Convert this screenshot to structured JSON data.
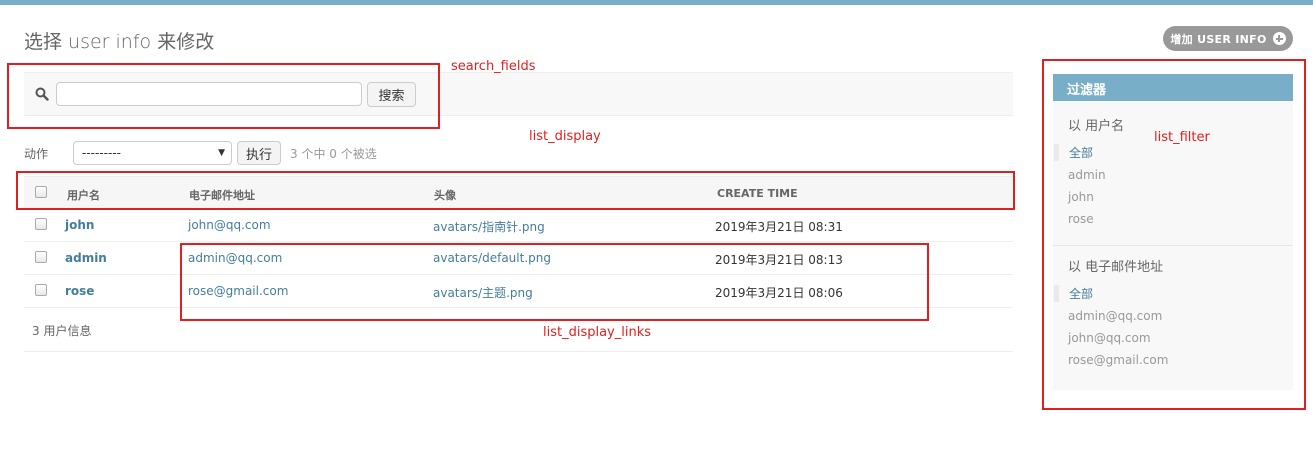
{
  "page": {
    "title": "选择 user info 来修改",
    "add_button": "增加 USER INFO"
  },
  "search": {
    "value": "",
    "button": "搜索"
  },
  "actions": {
    "label": "动作",
    "select_value": "---------",
    "go_button": "执行",
    "counter": "3 个中 0 个被选"
  },
  "table": {
    "columns": [
      "用户名",
      "电子邮件地址",
      "头像",
      "CREATE TIME"
    ],
    "rows": [
      {
        "username": "john",
        "email": "john@qq.com",
        "avatar": "avatars/指南针.png",
        "create_time": "2019年3月21日 08:31"
      },
      {
        "username": "admin",
        "email": "admin@qq.com",
        "avatar": "avatars/default.png",
        "create_time": "2019年3月21日 08:13"
      },
      {
        "username": "rose",
        "email": "rose@gmail.com",
        "avatar": "avatars/主题.png",
        "create_time": "2019年3月21日 08:06"
      }
    ],
    "footer": "3 用户信息"
  },
  "filter": {
    "title": "过滤器",
    "sections": [
      {
        "title": "以 用户名",
        "items": [
          "全部",
          "admin",
          "john",
          "rose"
        ],
        "selected": "全部"
      },
      {
        "title": "以 电子邮件地址",
        "items": [
          "全部",
          "admin@qq.com",
          "john@qq.com",
          "rose@gmail.com"
        ],
        "selected": "全部"
      }
    ]
  },
  "annotations": {
    "search_fields": "search_fields",
    "list_display": "list_display",
    "list_filter": "list_filter",
    "list_display_links": "list_display_links"
  },
  "colors": {
    "accent": "#79aec8",
    "link": "#447e9b",
    "annotation": "#e02020"
  }
}
